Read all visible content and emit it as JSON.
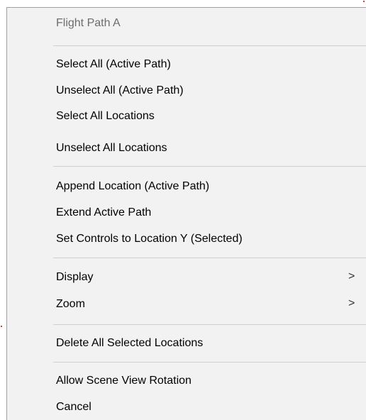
{
  "context_menu": {
    "title": "Flight Path A",
    "groups": [
      {
        "items": [
          {
            "label": "Select All (Active Path)"
          },
          {
            "label": "Unselect All (Active Path)"
          },
          {
            "label": "Select All Locations"
          },
          {
            "label": "Unselect All Locations"
          }
        ]
      },
      {
        "items": [
          {
            "label": "Append Location (Active Path)"
          },
          {
            "label": "Extend Active Path"
          },
          {
            "label": "Set Controls to Location Y (Selected)"
          }
        ]
      },
      {
        "items": [
          {
            "label": "Display",
            "submenu_indicator": ">"
          },
          {
            "label": "Zoom",
            "submenu_indicator": ">"
          }
        ]
      },
      {
        "items": [
          {
            "label": "Delete All Selected Locations"
          }
        ]
      },
      {
        "items": [
          {
            "label": "Allow Scene View Rotation"
          },
          {
            "label": "Cancel"
          }
        ]
      }
    ]
  },
  "colors": {
    "menu_background": "#f2f2f2",
    "menu_border": "#a0a0a0",
    "title_text": "#6d6d6d",
    "item_text": "#000000",
    "separator": "#cfcfcf"
  }
}
